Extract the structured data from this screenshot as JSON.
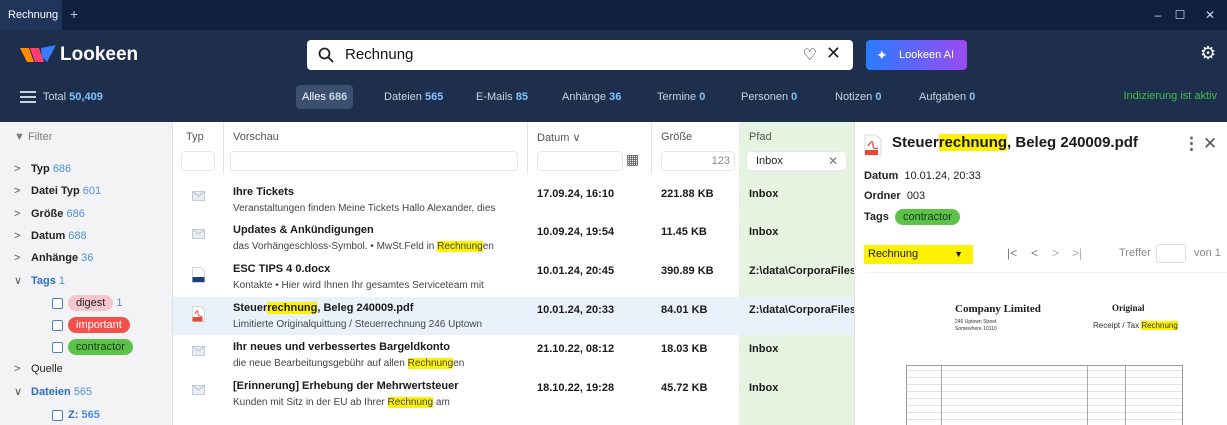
{
  "titlebar": {
    "tab_label": "Rechnung",
    "plus": "+",
    "minimize": "–",
    "maximize": "☐",
    "close": "✕"
  },
  "header": {
    "app_name": "Lookeen",
    "search": {
      "value": "Rechnung"
    },
    "ai_button": "Lookeen AI",
    "total_label": "Total",
    "total_value": "50,409",
    "categories": [
      {
        "label": "Alles",
        "count": "686"
      },
      {
        "label": "Dateien",
        "count": "565"
      },
      {
        "label": "E-Mails",
        "count": "85"
      },
      {
        "label": "Anhänge",
        "count": "36"
      },
      {
        "label": "Termine",
        "count": "0"
      },
      {
        "label": "Personen",
        "count": "0"
      },
      {
        "label": "Notizen",
        "count": "0"
      },
      {
        "label": "Aufgaben",
        "count": "0"
      }
    ],
    "indexing_status": "Indizierung ist aktiv"
  },
  "filter": {
    "title": "Filter",
    "items": [
      {
        "label": "Typ",
        "count": "686",
        "expanded": false
      },
      {
        "label": "Datei Typ",
        "count": "601",
        "expanded": false
      },
      {
        "label": "Größe",
        "count": "686",
        "expanded": false
      },
      {
        "label": "Datum",
        "count": "688",
        "expanded": false
      },
      {
        "label": "Anhänge",
        "count": "36",
        "expanded": false
      },
      {
        "label": "Tags",
        "count": "1",
        "expanded": true
      },
      {
        "label": "Quelle",
        "count": "",
        "expanded": false
      },
      {
        "label": "Dateien",
        "count": "565",
        "expanded": true
      }
    ],
    "tags": [
      {
        "label": "digest",
        "count": "1",
        "color": "#f6c5cf"
      },
      {
        "label": "important",
        "count": "",
        "color": "#f2504b"
      },
      {
        "label": "contractor",
        "count": "",
        "color": "#5dc24a"
      }
    ],
    "drive": {
      "label": "Z:",
      "count": "565"
    }
  },
  "table": {
    "columns": {
      "type": "Typ",
      "preview": "Vorschau",
      "date": "Datum",
      "size": "Größe",
      "path": "Pfad"
    },
    "size_filter_value": "123",
    "path_filter_value": "Inbox",
    "rows": [
      {
        "icon": "mail",
        "title_pre": "Ihre Tickets",
        "title_hl": "",
        "title_post": "",
        "prev_pre": "Veranstaltungen finden Meine Tickets Hallo Alexander, dies",
        "prev_hl": "",
        "prev_post": "",
        "date": "17.09.24, 16:10",
        "size": "221.88 KB",
        "path": "Inbox"
      },
      {
        "icon": "mail",
        "title_pre": "Updates & Ankündigungen",
        "title_hl": "",
        "title_post": "",
        "prev_pre": "das Vorhängeschloss-Symbol. • MwSt.Feld in ",
        "prev_hl": "Rechnung",
        "prev_post": "en",
        "date": "10.09.24, 19:54",
        "size": "11.45 KB",
        "path": "Inbox"
      },
      {
        "icon": "docx",
        "title_pre": "ESC TIPS 4 0.docx",
        "title_hl": "",
        "title_post": "",
        "prev_pre": "Kontakte • Hier wird Ihnen Ihr gesamtes Serviceteam mit",
        "prev_hl": "",
        "prev_post": "",
        "date": "10.01.24, 20:45",
        "size": "390.89 KB",
        "path": "Z:\\data\\CorporaFiles"
      },
      {
        "icon": "pdf",
        "title_pre": "Steuer",
        "title_hl": "rechnung",
        "title_post": ", Beleg 240009.pdf",
        "prev_pre": "Limitierte Originalquittung / Steuerrechnung 246 Uptown",
        "prev_hl": "",
        "prev_post": "",
        "date": "10.01.24, 20:33",
        "size": "84.01 KB",
        "path": "Z:\\data\\CorporaFiles",
        "selected": true
      },
      {
        "icon": "mail",
        "title_pre": "Ihr neues und verbessertes Bargeldkonto",
        "title_hl": "",
        "title_post": "",
        "prev_pre": "die neue Bearbeitungsgebühr auf allen ",
        "prev_hl": "Rechnung",
        "prev_post": "en",
        "date": "21.10.22, 08:12",
        "size": "18.03 KB",
        "path": "Inbox"
      },
      {
        "icon": "mail",
        "title_pre": "[Erinnerung] Erhebung der Mehrwertsteuer",
        "title_hl": "",
        "title_post": "",
        "prev_pre": "Kunden mit Sitz in der EU ab Ihrer ",
        "prev_hl": "Rechnung",
        "prev_post": " am",
        "date": "18.10.22, 19:28",
        "size": "45.72 KB",
        "path": "Inbox"
      }
    ]
  },
  "preview": {
    "title_pre": "Steuer",
    "title_hl": "rechnung",
    "title_post": ", Beleg 240009.pdf",
    "date_label": "Datum",
    "date_value": "10.01.24, 20:33",
    "folder_label": "Ordner",
    "folder_value": "003",
    "tags_label": "Tags",
    "tag": "contractor",
    "dropdown_value": "Rechnung",
    "treffer_label": "Treffer",
    "von_label": "von 1",
    "doc": {
      "company": "Company Limited",
      "original": "Original",
      "address_1": "246 Uptown Street",
      "address_2": "Somewhere 10110",
      "receipt_pre": "Receipt / Tax ",
      "receipt_hl": "Rechnung"
    }
  },
  "colors": {
    "accent": "#4a90d9",
    "highlight": "#fff200",
    "path_column": "#e7f3e1",
    "header_bg": "#1e2f4d",
    "status_green": "#3fbf4f"
  }
}
